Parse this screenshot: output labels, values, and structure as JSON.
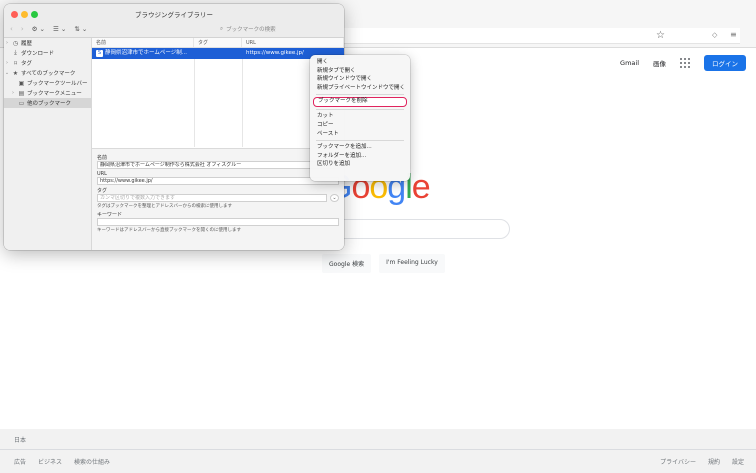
{
  "browser": {
    "gmail": "Gmail",
    "images": "画像",
    "login": "ログイン"
  },
  "google": {
    "logo": [
      "G",
      "o",
      "o",
      "g",
      "l",
      "e"
    ],
    "search_button": "Google 検索",
    "lucky_button": "I'm Feeling Lucky"
  },
  "footer": {
    "country": "日本",
    "left": [
      "広告",
      "ビジネス",
      "検索の仕組み"
    ],
    "right": [
      "プライバシー",
      "規約",
      "設定"
    ]
  },
  "library": {
    "title": "ブラウジングライブラリー",
    "search_placeholder": "ブックマークの検索",
    "sidebar": [
      {
        "label": "履歴",
        "icon": "clock-icon",
        "indent": 0,
        "twisty": "›"
      },
      {
        "label": "ダウンロード",
        "icon": "download-icon",
        "indent": 0,
        "twisty": ""
      },
      {
        "label": "タグ",
        "icon": "tag-icon",
        "indent": 0,
        "twisty": "›"
      },
      {
        "label": "すべてのブックマーク",
        "icon": "star-icon",
        "indent": 0,
        "twisty": "⌄"
      },
      {
        "label": "ブックマークツールバー",
        "icon": "toolbar-icon",
        "indent": 1,
        "twisty": ""
      },
      {
        "label": "ブックマークメニュー",
        "icon": "menu-icon",
        "indent": 1,
        "twisty": "›"
      },
      {
        "label": "他のブックマーク",
        "icon": "folder-icon",
        "indent": 1,
        "twisty": ""
      }
    ],
    "columns": {
      "name": "名前",
      "tag": "タグ",
      "url": "URL"
    },
    "row": {
      "name": "静岡県沼津市でホームページ制...",
      "tag": "",
      "url": "https://www.gikee.jp/"
    },
    "details": {
      "name_label": "名前",
      "name_value": "静岡県沼津市でホームページ制作なら株式会社 オフィスグルー",
      "url_label": "URL",
      "url_value": "https://www.gikee.jp/",
      "tag_label": "タグ",
      "tag_placeholder": "カンマ区切りで複数入力できます",
      "tag_hint": "タグはブックマークを整理とアドレスバーからの検索に使用します",
      "keyword_label": "キーワード",
      "keyword_value": "",
      "keyword_hint": "キーワードはアドレスバーから直接ブックマークを開くのに使用します"
    }
  },
  "context_menu": {
    "groups": [
      [
        "開く",
        "新規タブで開く",
        "新規ウインドウで開く",
        "新規プライベートウインドウで開く"
      ],
      [
        "ブックマークを削除"
      ],
      [
        "カット",
        "コピー",
        "ペースト"
      ],
      [
        "ブックマークを追加...",
        "フォルダーを追加...",
        "区切りを追加"
      ]
    ],
    "highlighted": "ブックマークを削除",
    "highlight_color": "#e0245e"
  },
  "colors": {
    "selection": "#1e5fd6",
    "login_button": "#1a73e8"
  }
}
